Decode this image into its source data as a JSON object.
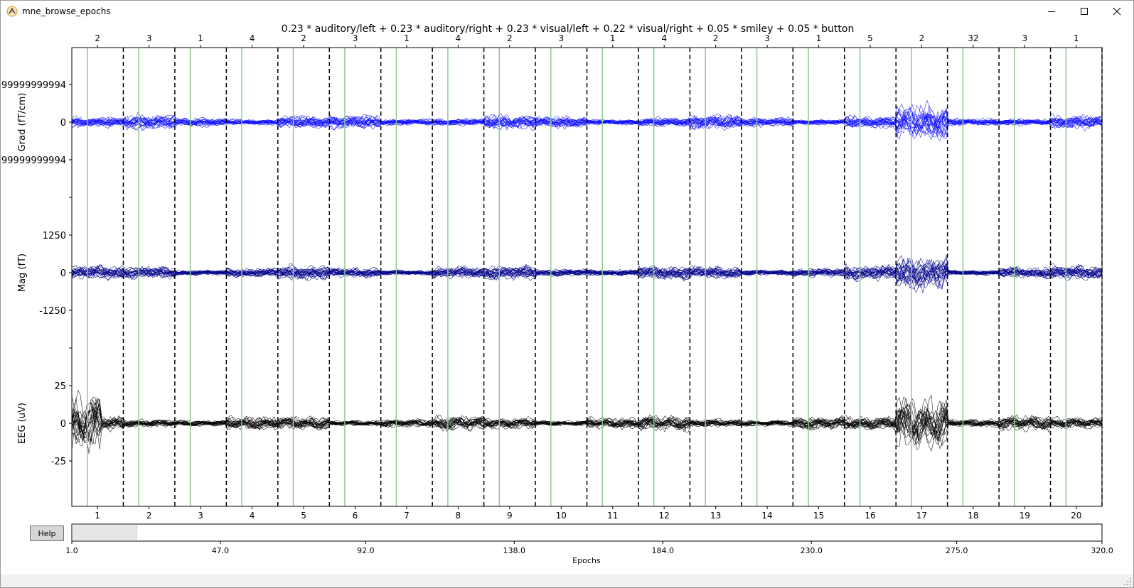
{
  "window": {
    "title": "mne_browse_epochs"
  },
  "plot": {
    "title": "0.23 * auditory/left + 0.23 * auditory/right + 0.23 * visual/left + 0.22 * visual/right + 0.05 * smiley + 0.05 * button",
    "channel_groups": [
      {
        "label": "Grad (fT/cm)",
        "ticks": [
          "99999999994",
          "0",
          "99999999994"
        ],
        "color": "#1010ff",
        "width": 1.0
      },
      {
        "label": "Mag (fT)",
        "ticks": [
          "1250",
          "0",
          "-1250"
        ],
        "color": "#00008b",
        "width": 1.0
      },
      {
        "label": "EEG (uV)",
        "ticks": [
          "25",
          "0",
          "-25"
        ],
        "color": "#000000",
        "width": 1.0
      }
    ],
    "epoch_numbers": [
      "1",
      "2",
      "3",
      "4",
      "5",
      "6",
      "7",
      "8",
      "9",
      "10",
      "11",
      "12",
      "13",
      "14",
      "15",
      "16",
      "17",
      "18",
      "19",
      "20"
    ],
    "event_ids": [
      "2",
      "3",
      "1",
      "4",
      "2",
      "3",
      "1",
      "4",
      "2",
      "3",
      "1",
      "4",
      "2",
      "3",
      "1",
      "5",
      "2",
      "32",
      "3",
      "1"
    ],
    "epoch_boundary_style": "black dashed",
    "event_line_color": "#90c890"
  },
  "controls": {
    "help_label": "Help",
    "scrollbar": {
      "tick_labels": [
        "1.0",
        "47.0",
        "92.0",
        "138.0",
        "184.0",
        "230.0",
        "275.0",
        "320.0"
      ],
      "xlabel": "Epochs",
      "min": 1.0,
      "max": 320.0,
      "view_start": 1.0,
      "view_end": 21.0
    }
  }
}
